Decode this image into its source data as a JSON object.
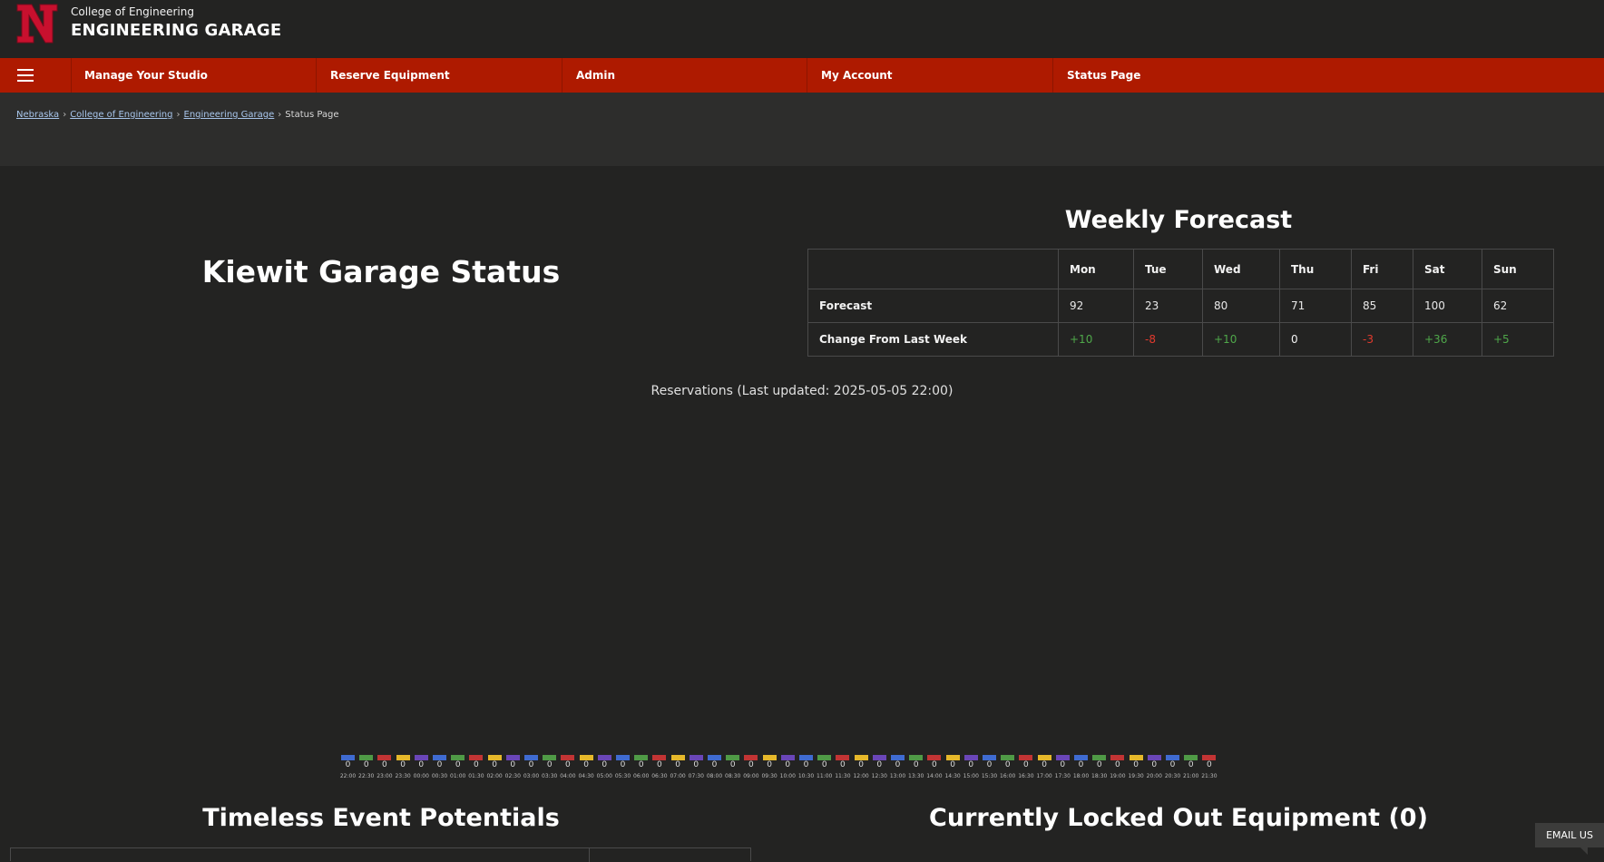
{
  "header": {
    "college": "College of Engineering",
    "site_title": "ENGINEERING GARAGE"
  },
  "nav": {
    "items": [
      {
        "label": "Manage Your Studio"
      },
      {
        "label": "Reserve Equipment"
      },
      {
        "label": "Admin"
      },
      {
        "label": "My Account"
      },
      {
        "label": "Status Page"
      }
    ]
  },
  "breadcrumb": {
    "items": [
      "Nebraska",
      "College of Engineering",
      "Engineering Garage",
      "Status Page"
    ]
  },
  "status": {
    "title": "Kiewit Garage Status"
  },
  "forecast": {
    "title": "Weekly Forecast",
    "days": [
      "Mon",
      "Tue",
      "Wed",
      "Thu",
      "Fri",
      "Sat",
      "Sun"
    ],
    "forecast_label": "Forecast",
    "forecast_values": [
      "92",
      "23",
      "80",
      "71",
      "85",
      "100",
      "62"
    ],
    "change_label": "Change From Last Week",
    "change_values": [
      "+10",
      "-8",
      "+10",
      "0",
      "-3",
      "+36",
      "+5"
    ]
  },
  "reservations": {
    "updated_text": "Reservations (Last updated: 2025-05-05 22:00)",
    "colors": [
      "#3f6bd1",
      "#4f9a46",
      "#c23434",
      "#e6b82a",
      "#6a46b8"
    ],
    "slots": [
      {
        "time": "22:00",
        "count": "0"
      },
      {
        "time": "22:30",
        "count": "0"
      },
      {
        "time": "23:00",
        "count": "0"
      },
      {
        "time": "23:30",
        "count": "0"
      },
      {
        "time": "00:00",
        "count": "0"
      },
      {
        "time": "00:30",
        "count": "0"
      },
      {
        "time": "01:00",
        "count": "0"
      },
      {
        "time": "01:30",
        "count": "0"
      },
      {
        "time": "02:00",
        "count": "0"
      },
      {
        "time": "02:30",
        "count": "0"
      },
      {
        "time": "03:00",
        "count": "0"
      },
      {
        "time": "03:30",
        "count": "0"
      },
      {
        "time": "04:00",
        "count": "0"
      },
      {
        "time": "04:30",
        "count": "0"
      },
      {
        "time": "05:00",
        "count": "0"
      },
      {
        "time": "05:30",
        "count": "0"
      },
      {
        "time": "06:00",
        "count": "0"
      },
      {
        "time": "06:30",
        "count": "0"
      },
      {
        "time": "07:00",
        "count": "0"
      },
      {
        "time": "07:30",
        "count": "0"
      },
      {
        "time": "08:00",
        "count": "0"
      },
      {
        "time": "08:30",
        "count": "0"
      },
      {
        "time": "09:00",
        "count": "0"
      },
      {
        "time": "09:30",
        "count": "0"
      },
      {
        "time": "10:00",
        "count": "0"
      },
      {
        "time": "10:30",
        "count": "0"
      },
      {
        "time": "11:00",
        "count": "0"
      },
      {
        "time": "11:30",
        "count": "0"
      },
      {
        "time": "12:00",
        "count": "0"
      },
      {
        "time": "12:30",
        "count": "0"
      },
      {
        "time": "13:00",
        "count": "0"
      },
      {
        "time": "13:30",
        "count": "0"
      },
      {
        "time": "14:00",
        "count": "0"
      },
      {
        "time": "14:30",
        "count": "0"
      },
      {
        "time": "15:00",
        "count": "0"
      },
      {
        "time": "15:30",
        "count": "0"
      },
      {
        "time": "16:00",
        "count": "0"
      },
      {
        "time": "16:30",
        "count": "0"
      },
      {
        "time": "17:00",
        "count": "0"
      },
      {
        "time": "17:30",
        "count": "0"
      },
      {
        "time": "18:00",
        "count": "0"
      },
      {
        "time": "18:30",
        "count": "0"
      },
      {
        "time": "19:00",
        "count": "0"
      },
      {
        "time": "19:30",
        "count": "0"
      },
      {
        "time": "20:00",
        "count": "0"
      },
      {
        "time": "20:30",
        "count": "0"
      },
      {
        "time": "21:00",
        "count": "0"
      },
      {
        "time": "21:30",
        "count": "0"
      }
    ]
  },
  "timeless": {
    "title": "Timeless Event Potentials"
  },
  "locked": {
    "title": "Currently Locked Out Equipment (0)"
  },
  "email": {
    "label": "EMAIL US"
  },
  "theme": {
    "brand_red": "#ae1a00",
    "background": "#232322",
    "positive": "#4fa84a",
    "negative": "#e23a2d"
  }
}
